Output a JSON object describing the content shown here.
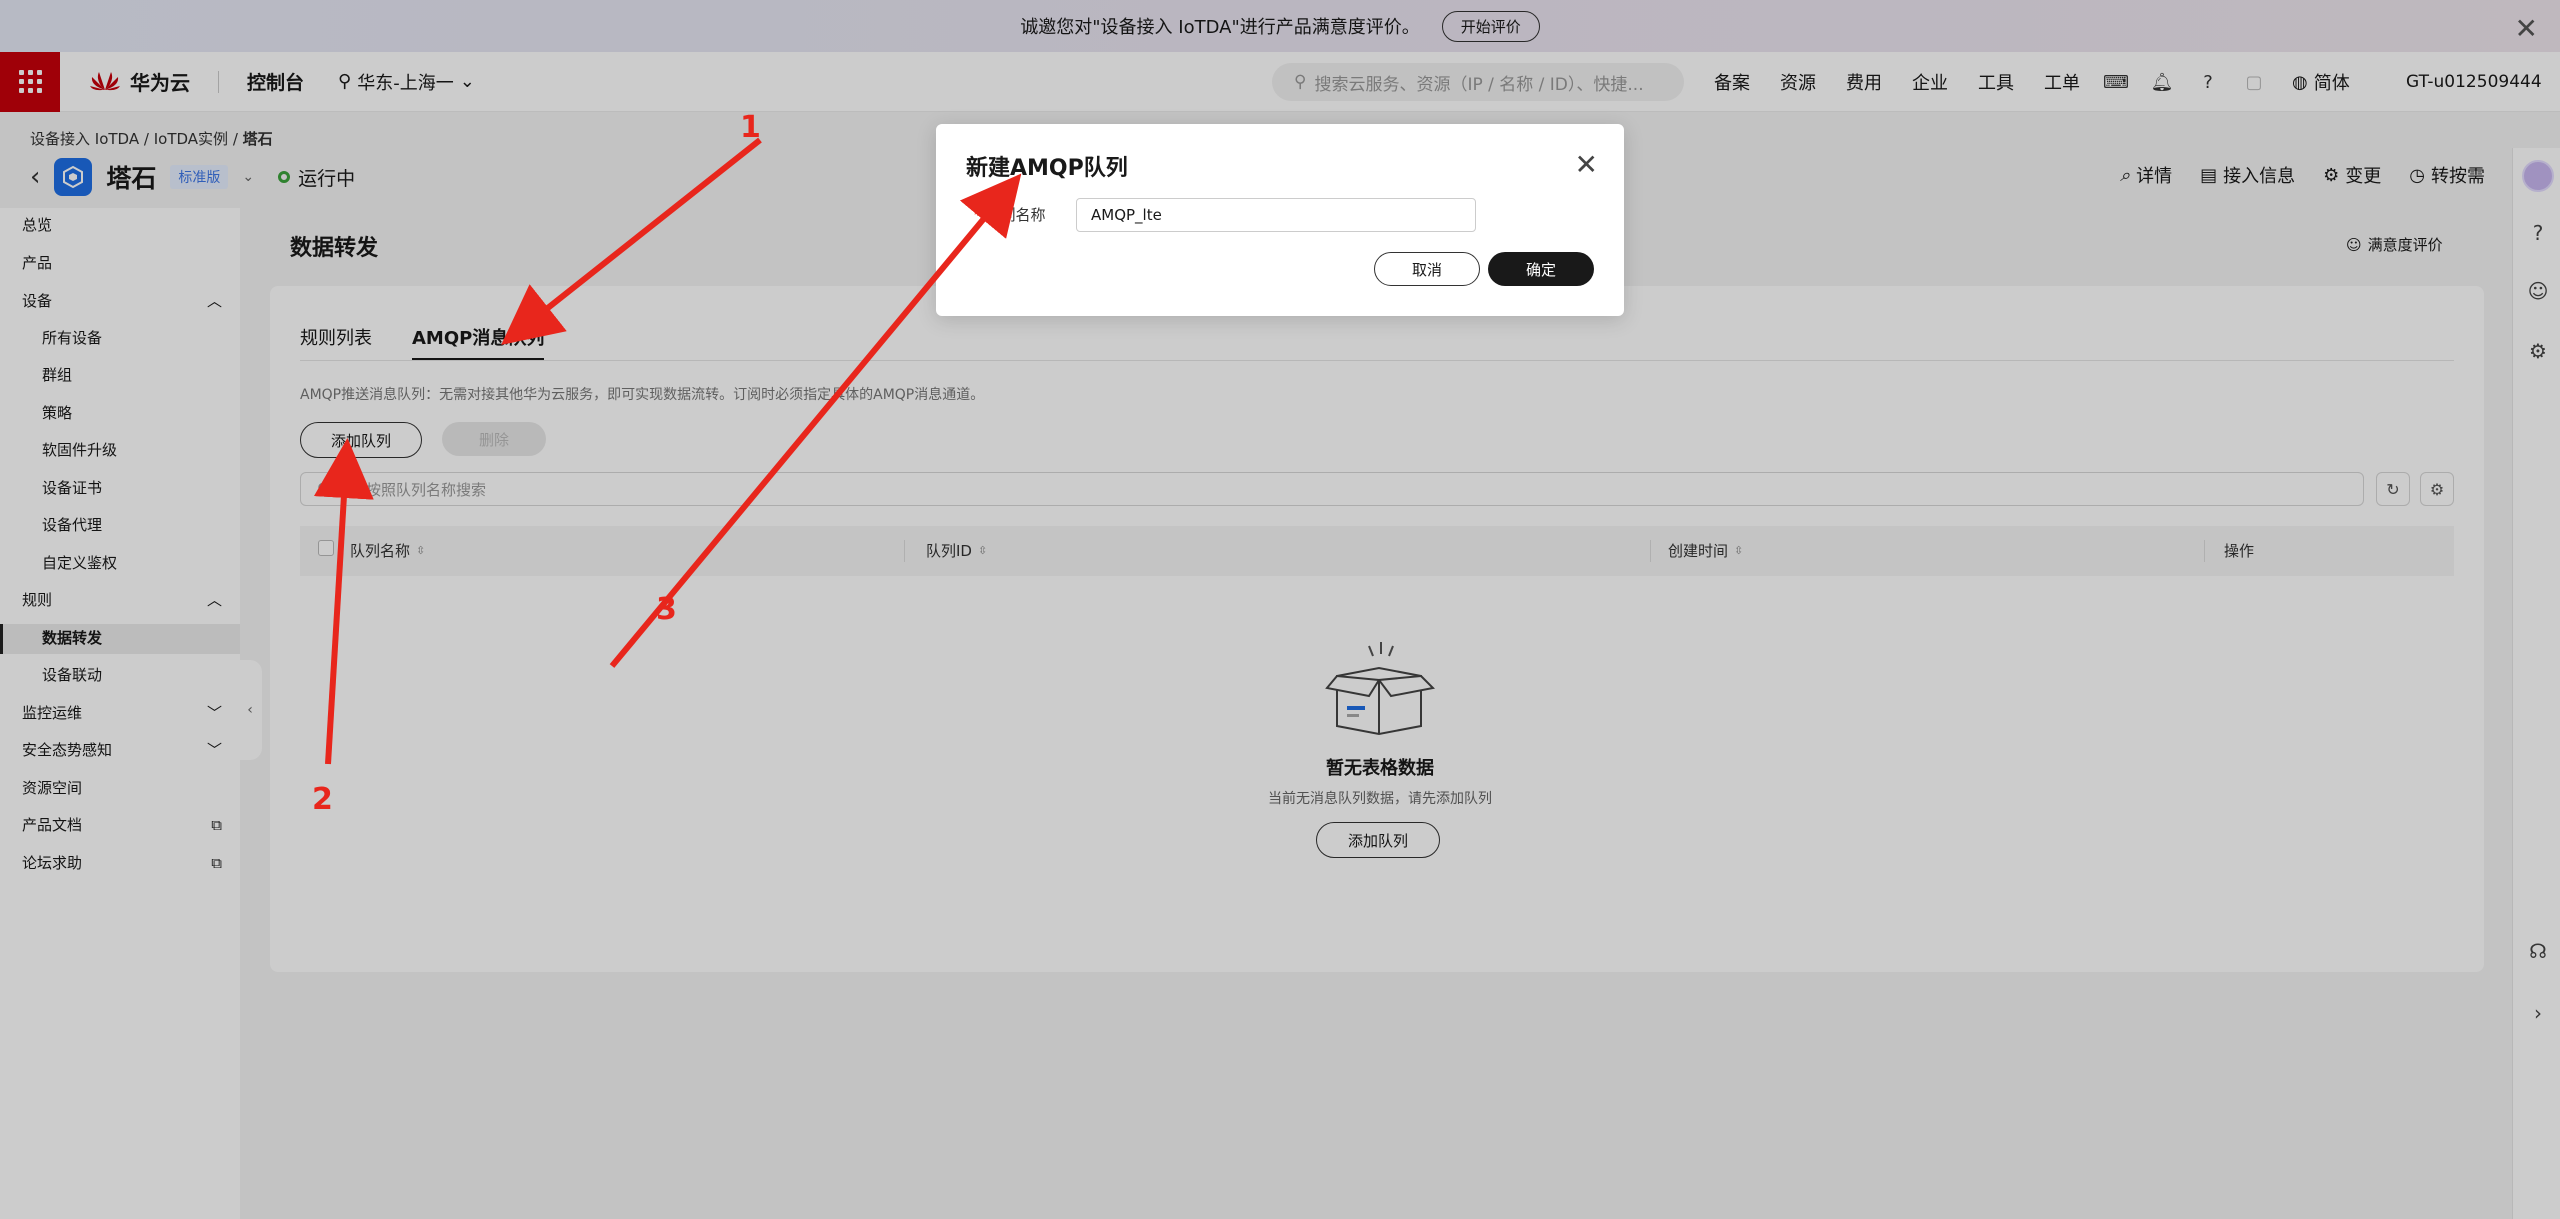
{
  "banner": {
    "text": "诚邀您对\"设备接入 IoTDA\"进行产品满意度评价。",
    "button": "开始评价"
  },
  "topnav": {
    "brand": "华为云",
    "brand_sub": "HUAWEI",
    "console": "控制台",
    "region": "华东-上海一",
    "search_placeholder": "搜索云服务、资源（IP / 名称 / ID）、快捷...",
    "menu": [
      "备案",
      "资源",
      "费用",
      "企业",
      "工具",
      "工单"
    ],
    "lang": "简体",
    "account": "GT-u012509444"
  },
  "breadcrumb": {
    "a": "设备接入 IoTDA",
    "b": "IoTDA实例",
    "c": "塔石",
    "sep": "/"
  },
  "instance": {
    "name": "塔石",
    "edition": "标准版",
    "status": "运行中"
  },
  "head_actions": [
    "详情",
    "接入信息",
    "变更",
    "转按需"
  ],
  "sidebar": {
    "items": [
      {
        "label": "总览"
      },
      {
        "label": "产品"
      },
      {
        "label": "设备"
      },
      {
        "label": "所有设备"
      },
      {
        "label": "群组"
      },
      {
        "label": "策略"
      },
      {
        "label": "软固件升级"
      },
      {
        "label": "设备证书"
      },
      {
        "label": "设备代理"
      },
      {
        "label": "自定义鉴权"
      },
      {
        "label": "规则"
      },
      {
        "label": "数据转发"
      },
      {
        "label": "设备联动"
      },
      {
        "label": "监控运维"
      },
      {
        "label": "安全态势感知"
      },
      {
        "label": "资源空间"
      },
      {
        "label": "产品文档"
      },
      {
        "label": "论坛求助"
      }
    ]
  },
  "main": {
    "title": "数据转发",
    "satisfaction": "满意度评价",
    "tabs": [
      "规则列表",
      "AMQP消息队列"
    ],
    "description": "AMQP推送消息队列：无需对接其他华为云服务，即可实现数据流转。订阅时必须指定具体的AMQP消息通道。",
    "add_button": "添加队列",
    "delete_button": "删除",
    "filter_placeholder": "默认按照队列名称搜索",
    "columns": [
      "队列名称",
      "队列ID",
      "创建时间",
      "操作"
    ],
    "empty_title": "暂无表格数据",
    "empty_sub": "当前无消息队列数据，请先添加队列",
    "empty_button": "添加队列"
  },
  "modal": {
    "title": "新建AMQP队列",
    "field_label": "队列名称",
    "field_value": "AMQP_lte",
    "cancel": "取消",
    "ok": "确定"
  },
  "annotations": [
    "1",
    "2",
    "3"
  ],
  "colors": {
    "brand_red": "#c7000b",
    "arrow_red": "#e8261c",
    "status_green": "#3ba33b",
    "primary_dark": "#191919"
  }
}
